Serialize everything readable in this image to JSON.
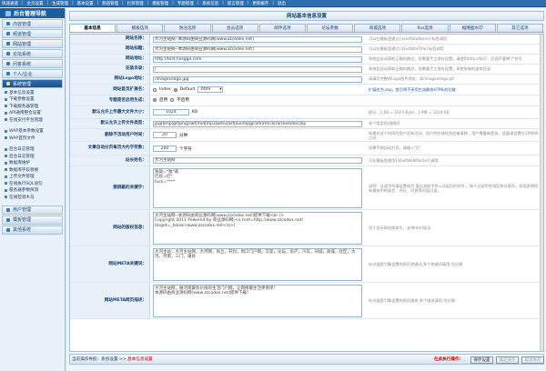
{
  "topnav": [
    "快速通道",
    "主页设置",
    "生成管理",
    "基本设置",
    "频道管理",
    "栏目管理",
    "模板管理",
    "专题管理",
    "系统信息",
    "留言管理",
    "更新缓存",
    "退出"
  ],
  "sidebar": {
    "brand": "后台管理导航",
    "top_heads": [
      "内容管理",
      "频道管理",
      "网站管理",
      "论坛系统",
      "问答系统",
      "个人/企业"
    ],
    "section1": {
      "title": "系统管理",
      "links": [
        "基本信息设置",
        "下载参数设置",
        "下载服务器管理",
        "API通用整合设置",
        "在线支付平台管理"
      ]
    },
    "section2": {
      "links": [
        "WAP基本参数设置",
        "WAP首页文件"
      ]
    },
    "section3": {
      "links": [
        "后台日志管理",
        "后台日志管理",
        "数据库维护",
        "数据库字段替换",
        "上传文件管理",
        "在线执行SQL语句",
        "服务器参数探测",
        "在线检测木马"
      ]
    },
    "bottom_heads": [
      "用户管理",
      "模板管理",
      "其他系统"
    ]
  },
  "panel_title": "网站基本信息设置",
  "tabs": [
    "基本信息",
    "模板选项",
    "防注选项",
    "会员选项",
    "邮件选项",
    "论坛参数",
    "商城选项",
    "Rss选项",
    "缩略图水印",
    "其它选项"
  ],
  "rows": {
    "site_name": {
      "label": "网站名称：",
      "value": "大河主站网--本源码由商业源码网[www.zzcodex.net]",
      "hint": "可以在模板里通过{$GetSiteName}标签调用"
    },
    "site_title": {
      "label": "网站标题：",
      "value": "大河主站网--本源码由商业源码网[www.zzcodex.net]",
      "hint": "可以在模板里通过{$GetSiteTitle}标签调用"
    },
    "site_url": {
      "label": "网站地址：",
      "value": "http://test.hosgge.com",
      "hint": "系统会自动获取正确的路径，但需要手工保存设置。请使用http://标识，后面不要带\"/\"符号"
    },
    "install_dir": {
      "label": "安装目录：",
      "value": "/",
      "hint": "系统会自动获取正确的路径，但需要手工保存设置。系统安装的虚拟目录"
    },
    "logo": {
      "label": "网站Logo地址：",
      "value": "/images/logo.jpg",
      "hint": "请填写完整的Logo图片地址，如/images/logo.gif"
    },
    "home_ext": {
      "label": "网站首页扩展名：",
      "opt1": "Index",
      "opt2": "Default",
      "select": ".html",
      "hint": "扩展名为.asp，首页将不采用生成静态HTML的功能"
    },
    "open_site": {
      "label": "专题是否启用生成：",
      "yes": "启用",
      "no": "不启用"
    },
    "upload_size": {
      "label": "默认允许上传最大文件大小：",
      "value": "1024",
      "unit": "KB",
      "hint": "提示：1 KB = 1024 Byte，1 MB = 1024 KB"
    },
    "upload_types": {
      "label": "默认允许上传文件类型：",
      "value": "jpg|bmp|gif|png|swf|mid|mp3|wmv|asf|avi|mpg|ram|rm|ra|rar|exe|doc|zip",
      "hint": "多个类型用|线隔开"
    },
    "delete_time": {
      "label": "删除不活动用户时间：",
      "value": "20",
      "unit": "分钟",
      "hint": "如果在这个时间内用户没有活动，用户的在线状态会被清除，用户需重新登录，此值请设置在1到900之间"
    },
    "auto_pages": {
      "label": "文章自动分页每页大约字符数：",
      "value": "200",
      "unit": "个字符",
      "hint": "如果不想自动分页，请输入\"0\""
    },
    "webmaster": {
      "label": "站长姓名：",
      "value": "大河主站网",
      "hint": "可在模板里使用{$GetWebMaster}调用"
    },
    "filter_words": {
      "label": "要屏蔽的关键字：",
      "value": "独裁=*独*裁\n烂屁=烂*\nfuck=****",
      "hint": "说明：过滤字符请设置成为 要过滤的字符=过滤后的字符 ，每个过滤字符用回车分割开。如用说明所有模块中的留言、评论、问答等内容过滤。"
    },
    "copyright": {
      "label": "网站的版权信息：",
      "value": "大河主站网--本源码由商业源码网[www.zzcodex.net]提供下载<br />\nCopyright 2011 Powered by 商业源码网[<a href=http://www.zzcodex.net/ target=_blank>www.zzcodex.net</a>]",
      "hint": "用于显示网站版本号，支持html语法"
    },
    "meta_keywords": {
      "label": "网站META关键词：",
      "value": "大河主站，大河主站网，大河网，商丘，开封，周口门户网，交友，论坛，房产，汽车，同城，商城，社区，大河，河南，三门，蒲县",
      "hint": "针对搜索引擎设置的网页关键词,多个关键词请用,号分隔"
    },
    "meta_desc": {
      "label": "网站META网页描述：",
      "value": "大河主站网，做河南最有价值的生活门户网，让网络最生活更简单！\n本源码由商业源码网[www.zzcodex.net]提供下载！",
      "hint": "针对搜索引擎设置的网页描述,多个描述请用,号分隔"
    }
  },
  "footer": {
    "location_prefix": "当前操作导航：系统设置 >> ",
    "location_current": "基本信息设置",
    "action_label": "在此执行操作：",
    "buttons": [
      "保存设置",
      "确定保存",
      "取消保存"
    ]
  }
}
